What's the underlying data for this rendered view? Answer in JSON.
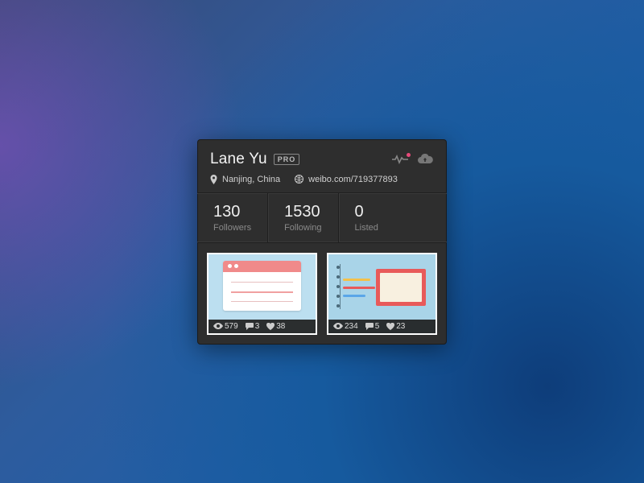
{
  "profile": {
    "name": "Lane Yu",
    "badge": "PRO",
    "location": "Nanjing, China",
    "website": "weibo.com/719377893"
  },
  "stats": {
    "followers": {
      "value": "130",
      "label": "Followers"
    },
    "following": {
      "value": "1530",
      "label": "Following"
    },
    "listed": {
      "value": "0",
      "label": "Listed"
    }
  },
  "shots": [
    {
      "views": "579",
      "comments": "3",
      "likes": "38"
    },
    {
      "views": "234",
      "comments": "5",
      "likes": "23"
    }
  ],
  "colors": {
    "card_bg": "#2e2e2e",
    "accent_pink": "#e84a7a"
  }
}
